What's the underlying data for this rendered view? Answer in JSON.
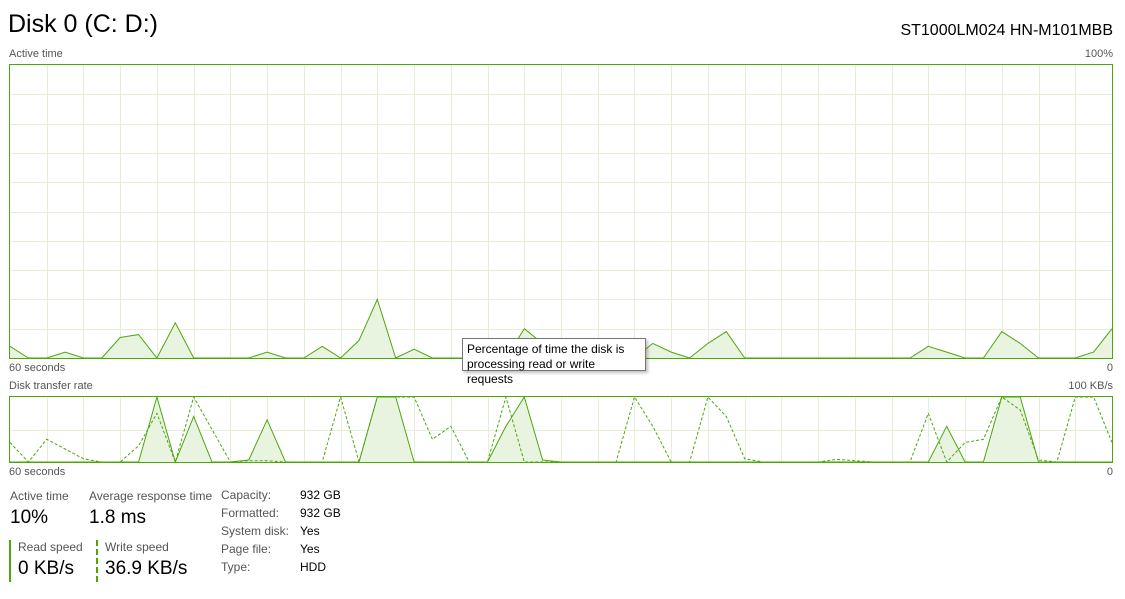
{
  "header": {
    "title": "Disk 0 (C: D:)",
    "model": "ST1000LM024 HN-M101MBB"
  },
  "active_time_graph": {
    "label": "Active time",
    "max_label": "100%",
    "time_label": "60 seconds",
    "min_label": "0",
    "samples": [
      4,
      0,
      0,
      2,
      0,
      0,
      7,
      8,
      0,
      12,
      0,
      0,
      0,
      0,
      2,
      0,
      0,
      4,
      0,
      6,
      20,
      0,
      3,
      0,
      0,
      0,
      0,
      0,
      10,
      5,
      0,
      0,
      0,
      0,
      0,
      5,
      2,
      0,
      5,
      9,
      0,
      0,
      0,
      0,
      0,
      0,
      0,
      0,
      0,
      0,
      4,
      2,
      0,
      0,
      9,
      5,
      0,
      0,
      0,
      2,
      10
    ],
    "line_color": "#4da60c",
    "fill_color": "#e9f4e0",
    "grid_color": "#e3efd7"
  },
  "transfer_graph": {
    "label": "Disk transfer rate",
    "max_label": "100 KB/s",
    "time_label": "60 seconds",
    "min_label": "0",
    "read_samples": [
      0,
      0,
      0,
      0,
      0,
      0,
      0,
      0,
      100,
      0,
      70,
      0,
      0,
      3,
      65,
      0,
      0,
      0,
      0,
      0,
      100,
      100,
      0,
      0,
      0,
      0,
      0,
      55,
      100,
      3,
      0,
      0,
      0,
      0,
      0,
      0,
      0,
      0,
      0,
      0,
      0,
      0,
      0,
      0,
      0,
      0,
      0,
      0,
      0,
      0,
      0,
      55,
      0,
      0,
      100,
      100,
      0,
      0,
      0,
      0,
      0
    ],
    "write_samples": [
      30,
      0,
      35,
      20,
      5,
      0,
      0,
      25,
      75,
      0,
      100,
      50,
      0,
      2,
      2,
      0,
      0,
      0,
      100,
      0,
      100,
      100,
      100,
      35,
      55,
      0,
      0,
      100,
      0,
      0,
      0,
      0,
      0,
      0,
      100,
      55,
      0,
      0,
      100,
      70,
      5,
      0,
      0,
      0,
      0,
      4,
      2,
      0,
      0,
      0,
      75,
      0,
      30,
      35,
      100,
      80,
      3,
      0,
      100,
      100,
      30
    ],
    "line_color": "#4da60c",
    "fill_color": "#e9f4e0",
    "grid_color": "#e3efd7"
  },
  "tooltip": {
    "line1": "Percentage of time the disk is",
    "line2": "processing read or write requests"
  },
  "stats": {
    "active_time_label": "Active time",
    "active_time_value": "10%",
    "response_label": "Average response time",
    "response_value": "1.8 ms",
    "read_label": "Read speed",
    "read_value": "0 KB/s",
    "write_label": "Write speed",
    "write_value": "36.9 KB/s"
  },
  "properties": [
    {
      "key": "Capacity:",
      "value": "932 GB"
    },
    {
      "key": "Formatted:",
      "value": "932 GB"
    },
    {
      "key": "System disk:",
      "value": "Yes"
    },
    {
      "key": "Page file:",
      "value": "Yes"
    },
    {
      "key": "Type:",
      "value": "HDD"
    }
  ]
}
